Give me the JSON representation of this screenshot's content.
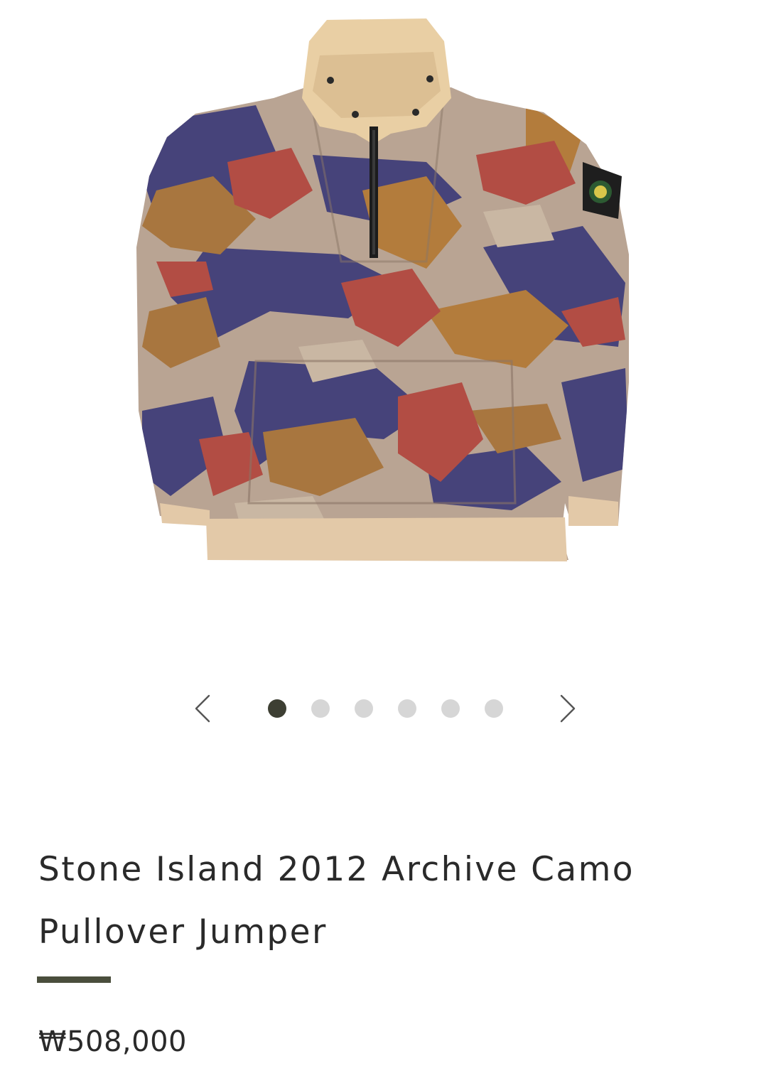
{
  "product": {
    "title": "Stone Island 2012 Archive Camo Pullover Jumper",
    "price": "₩508,000",
    "image_icon": "camo-pullover-photo"
  },
  "carousel": {
    "prev_icon": "chevron-left-icon",
    "next_icon": "chevron-right-icon",
    "total_slides": 6,
    "current_slide": 1,
    "active_dot_color": "#3d3f33",
    "inactive_dot_color": "#d6d6d6"
  },
  "accent_color": "#4a4e3c"
}
